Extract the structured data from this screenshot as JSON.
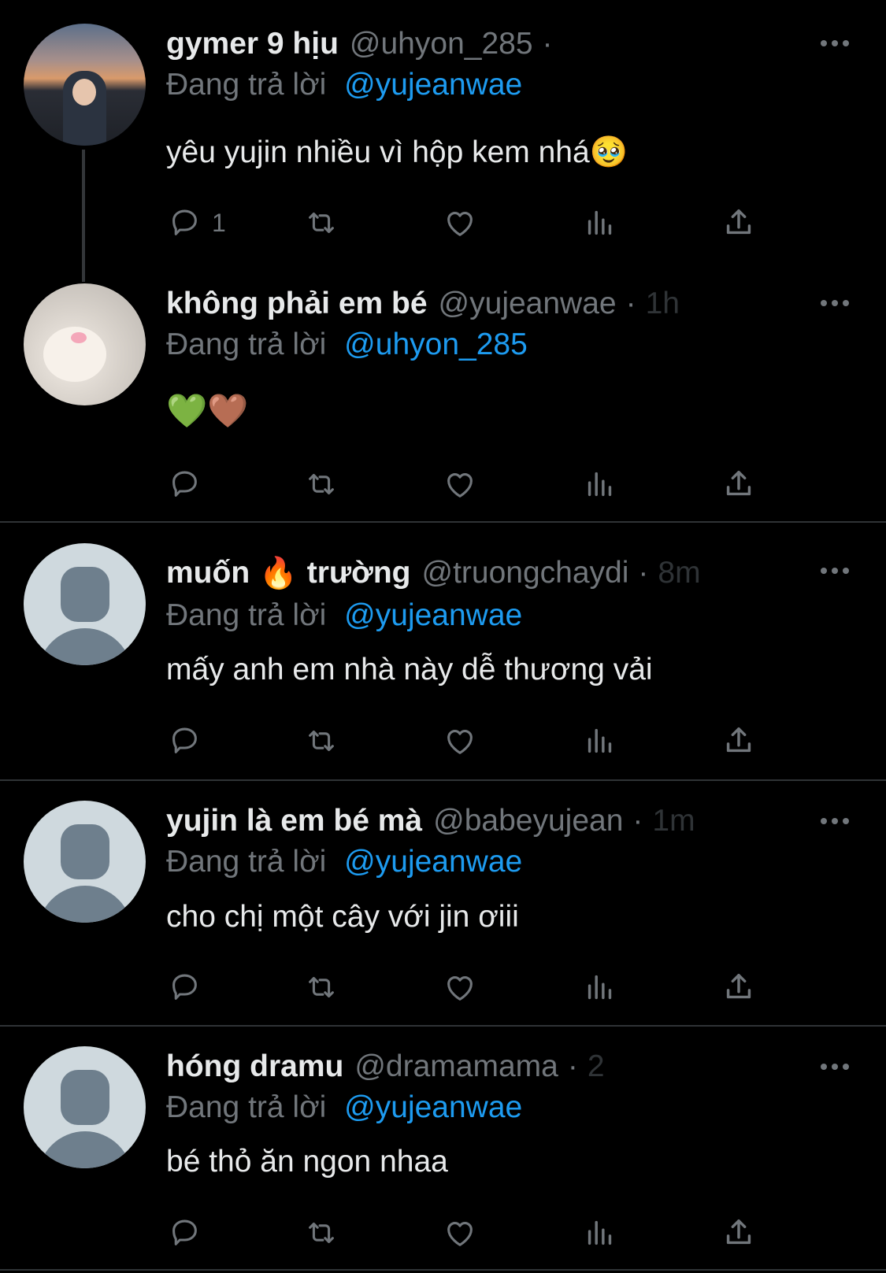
{
  "tweets": [
    {
      "name": "gymer 9 hịu",
      "handle": "@uhyon_285",
      "dot": "·",
      "faded": "",
      "reply_prefix": "Đang trả lời",
      "reply_to": "@yujeanwae",
      "text": "yêu yujin nhiều vì hộp kem nhá🥹",
      "reply_count": "1"
    },
    {
      "name": "không phải em bé",
      "handle": "@yujeanwae",
      "dot": "·",
      "faded": "1h",
      "reply_prefix": "Đang trả lời",
      "reply_to": "@uhyon_285",
      "text": "💚🤎",
      "reply_count": ""
    },
    {
      "name_part1": "muốn",
      "name_emoji": "🔥",
      "name_part2": "trường",
      "handle": "@truongchaydi",
      "dot": "·",
      "faded": "8m",
      "reply_prefix": "Đang trả lời",
      "reply_to": "@yujeanwae",
      "text": "mấy anh em nhà này dễ thương vải",
      "reply_count": ""
    },
    {
      "name": "yujin là em bé mà",
      "handle": "@babeyujean",
      "dot": "·",
      "faded": "1m",
      "reply_prefix": "Đang trả lời",
      "reply_to": "@yujeanwae",
      "text": "cho chị một cây với jin ơiii",
      "reply_count": ""
    },
    {
      "name": "hóng dramu",
      "handle": "@dramamama",
      "dot": "·",
      "faded": "2",
      "reply_prefix": "Đang trả lời",
      "reply_to": "@yujeanwae",
      "text": "bé thỏ ăn ngon nhaa",
      "reply_count": ""
    }
  ],
  "icons": {
    "more": "more-horizontal-icon",
    "reply": "reply-icon",
    "retweet": "retweet-icon",
    "like": "heart-icon",
    "views": "views-icon",
    "share": "share-icon"
  },
  "colors": {
    "background": "#000000",
    "text": "#e7e9ea",
    "muted": "#71767b",
    "accent": "#1d9bf0",
    "divider": "#2f3336"
  }
}
